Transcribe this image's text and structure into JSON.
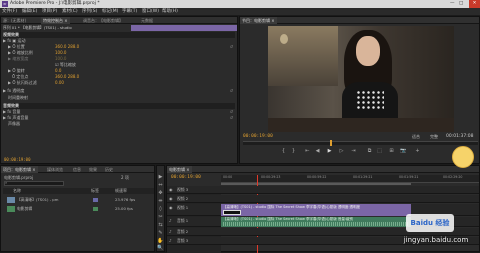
{
  "window": {
    "title": "Adobe Premiere Pro - J:\\电影剪辑.prproj *",
    "controls": {
      "minimize": "—",
      "maximize": "□",
      "close": "✕"
    }
  },
  "menu": [
    "文件(F)",
    "编辑(E)",
    "项目(P)",
    "素材(C)",
    "序列(S)",
    "标记(M)",
    "字幕(T)",
    "窗口(W)",
    "帮助(H)"
  ],
  "source_panel": {
    "tabs": [
      "源：(无素材)",
      "特效控制台 ×",
      "调音台：【电影剪辑】",
      "元数据"
    ],
    "sequence_label": "序列 01 * 【电影剪辑】(TS01) - studio",
    "rows": [
      {
        "label": "视频效果",
        "value": "",
        "type": "section"
      },
      {
        "label": "▶ fx ▣ 运动",
        "value": "",
        "type": "item"
      },
      {
        "label": "▶ Ö 位置",
        "value": "360.0    288.0",
        "type": "param"
      },
      {
        "label": "▶ Ö 缩放比例",
        "value": "100.0",
        "type": "param"
      },
      {
        "label": "▶ 缩放宽度",
        "value": "100.0",
        "type": "param"
      },
      {
        "label": "",
        "value": "☑ 等比缩放",
        "type": "check"
      },
      {
        "label": "▶ Ö 旋转",
        "value": "0.0",
        "type": "param"
      },
      {
        "label": "Ö 定位点",
        "value": "360.0    288.0",
        "type": "param"
      },
      {
        "label": "▶ Ö 抗闪烁过滤",
        "value": "0.00",
        "type": "param"
      },
      {
        "label": "▶ fx 透明度",
        "value": "",
        "type": "item"
      },
      {
        "label": "时间重映射",
        "value": "",
        "type": "item"
      },
      {
        "label": "音频效果",
        "value": "",
        "type": "section"
      },
      {
        "label": "▶ fx 音量",
        "value": "",
        "type": "item"
      },
      {
        "label": "▶ fx 声道音量",
        "value": "",
        "type": "item"
      },
      {
        "label": "声像器",
        "value": "",
        "type": "item"
      }
    ],
    "timecode": "00:00:19:00"
  },
  "program_panel": {
    "tab": "节目：电影剪辑 ×",
    "timecode_left": "00:00:19:00",
    "fit": "适合",
    "full": "完整",
    "timecode_right": "00:01:37:08",
    "buttons": [
      "{",
      "}",
      "⇤",
      "◀",
      "▶",
      "▷",
      "⇥",
      "⧉",
      "⬚",
      "⊞",
      "📷",
      "+"
    ]
  },
  "project_panel": {
    "tabs": [
      "项目：电影剪辑 ×",
      "媒体浏览",
      "信息",
      "效果",
      "历史"
    ],
    "file": "电影剪辑.prproj",
    "count": "2 项",
    "columns": [
      "名称",
      "标签",
      "帧速率"
    ],
    "items": [
      {
        "name": "【高清晰】(TS01) - pm",
        "rate": "23.976 fps"
      },
      {
        "name": "电影剪辑",
        "rate": "25.00 fps"
      }
    ]
  },
  "tools": [
    "▶",
    "⇔",
    "✥",
    "⇹",
    "◊",
    "✂",
    "⇆",
    "✎",
    "✋",
    "🔍"
  ],
  "timeline": {
    "tab": "电影剪辑 ×",
    "timecode": "00:00:19:00",
    "ruler": [
      "00:00",
      "00:00:29:23",
      "00:00:59:22",
      "00:01:29:21",
      "00:01:59:21",
      "00:02:29:20"
    ],
    "tracks": [
      {
        "label": "视频 3",
        "kind": "video",
        "clip": ""
      },
      {
        "label": "视频 2",
        "kind": "video",
        "clip": ""
      },
      {
        "label": "视频 1",
        "kind": "video",
        "clip": "【高清晰】(TS01) - studio 国际 The Secret Show 李宇春(华语)心愿版 透明度:透明度"
      },
      {
        "label": "音频 1",
        "kind": "audio",
        "clip": "【高清晰】(TS01) - studio 国际 The Secret Show 李宇春(华语)心愿版 音量:级别"
      },
      {
        "label": "音频 2",
        "kind": "audio",
        "clip": ""
      },
      {
        "label": "音频 3",
        "kind": "audio",
        "clip": ""
      }
    ]
  },
  "watermark": {
    "text": "jingyan.baidu.com",
    "brand": "Baidu 经验"
  },
  "colors": {
    "accent": "#e0a030",
    "video_clip": "#7b66a6",
    "audio_clip": "#3f7a5c",
    "playhead": "#e03a2a"
  }
}
